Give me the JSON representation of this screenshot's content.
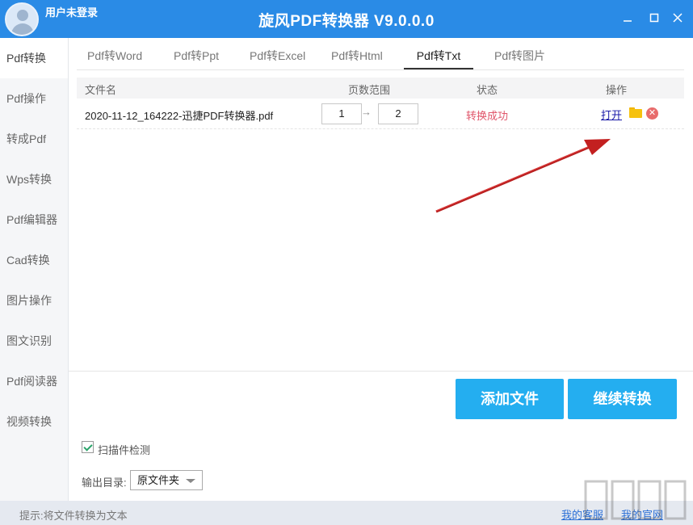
{
  "titlebar": {
    "user_label": "用户未登录",
    "app_title": "旋风PDF转换器 V9.0.0.0",
    "minimize_glyph": "□",
    "maximize_glyph": "□",
    "close_glyph": "✕"
  },
  "sidebar": {
    "items": [
      {
        "label": "Pdf转换",
        "active": true
      },
      {
        "label": "Pdf操作"
      },
      {
        "label": "转成Pdf"
      },
      {
        "label": "Wps转换"
      },
      {
        "label": "Pdf编辑器"
      },
      {
        "label": "Cad转换"
      },
      {
        "label": "图片操作"
      },
      {
        "label": "图文识别"
      },
      {
        "label": "Pdf阅读器"
      },
      {
        "label": "视频转换"
      }
    ]
  },
  "tabs": [
    {
      "label": "Pdf转Word"
    },
    {
      "label": "Pdf转Ppt"
    },
    {
      "label": "Pdf转Excel"
    },
    {
      "label": "Pdf转Html"
    },
    {
      "label": "Pdf转Txt",
      "active": true
    },
    {
      "label": "Pdf转图片"
    }
  ],
  "table": {
    "headers": {
      "filename": "文件名",
      "page_range": "页数范围",
      "status": "状态",
      "action": "操作"
    },
    "rows": [
      {
        "filename": "2020-11-12_164222-迅捷PDF转换器.pdf",
        "page_from": "1",
        "page_to": "2",
        "range_arrow": "→",
        "status": "转换成功",
        "open_label": "打开",
        "delete_glyph": "✕"
      }
    ]
  },
  "actions": {
    "add_file": "添加文件",
    "continue_convert": "继续转换"
  },
  "options": {
    "scan_detect_label": "扫描件检测",
    "scan_detect_checked": true,
    "output_dir_label": "输出目录:",
    "output_dir_value": "原文件夹"
  },
  "statusbar": {
    "hint": "提示:将文件转换为文本",
    "support_link": "我的客服",
    "website_link": "我的官网"
  },
  "colors": {
    "titlebar": "#2a8be6",
    "primary_button": "#24aef0",
    "status_success": "#e0556a",
    "annotation_arrow": "#d42a2a"
  }
}
